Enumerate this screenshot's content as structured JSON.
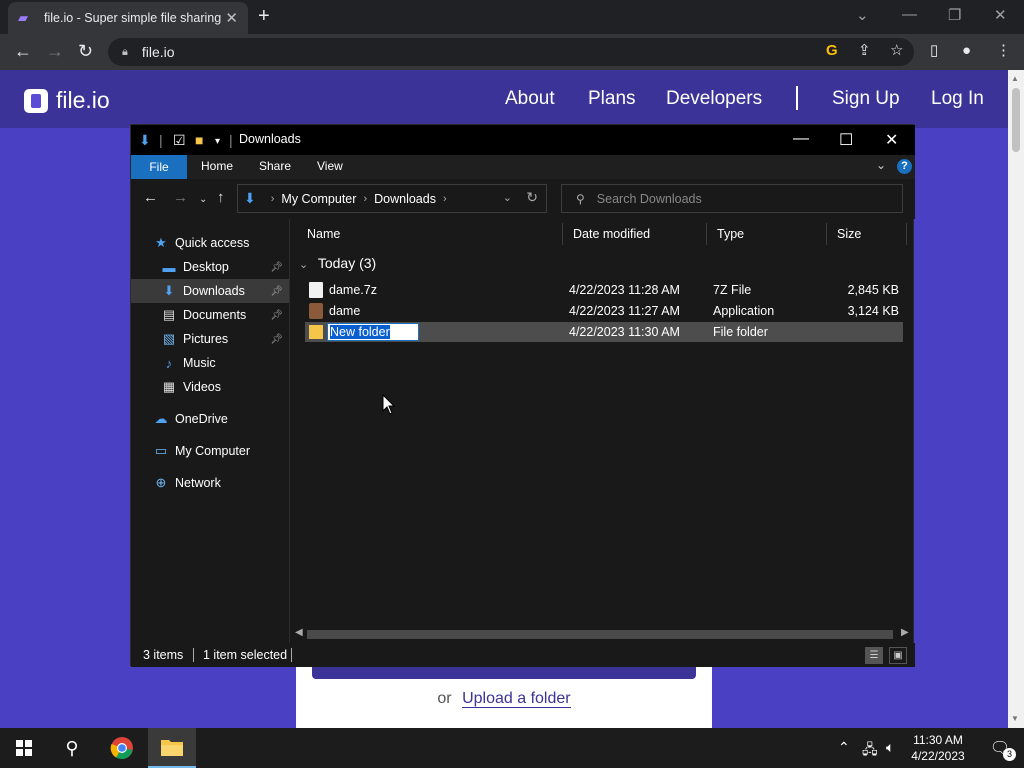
{
  "browser": {
    "tab_title": "file.io - Super simple file sharing",
    "tab_close": "✕",
    "new_tab": "+",
    "url": "file.io"
  },
  "site": {
    "logo_text": "file.io",
    "nav": {
      "about": "About",
      "plans": "Plans",
      "developers": "Developers",
      "signup": "Sign Up",
      "login": "Log In"
    },
    "upload_or": "or",
    "upload_folder": "Upload a folder"
  },
  "explorer": {
    "title": "Downloads",
    "ribbon": {
      "file": "File",
      "home": "Home",
      "share": "Share",
      "view": "View",
      "help": "?"
    },
    "breadcrumb": [
      "My Computer",
      "Downloads"
    ],
    "search_placeholder": "Search Downloads",
    "nav_items": [
      {
        "label": "Quick access",
        "icon": "star-icon"
      },
      {
        "label": "Desktop",
        "icon": "desktop-icon"
      },
      {
        "label": "Downloads",
        "icon": "download-icon"
      },
      {
        "label": "Documents",
        "icon": "document-icon"
      },
      {
        "label": "Pictures",
        "icon": "picture-icon"
      },
      {
        "label": "Music",
        "icon": "music-icon"
      },
      {
        "label": "Videos",
        "icon": "video-icon"
      },
      {
        "label": "OneDrive",
        "icon": "cloud-icon"
      },
      {
        "label": "My Computer",
        "icon": "computer-icon"
      },
      {
        "label": "Network",
        "icon": "network-icon"
      }
    ],
    "columns": {
      "name": "Name",
      "date": "Date modified",
      "type": "Type",
      "size": "Size"
    },
    "group_label": "Today (3)",
    "files": [
      {
        "name": "dame.7z",
        "date": "4/22/2023 11:28 AM",
        "type": "7Z File",
        "size": "2,845 KB"
      },
      {
        "name": "dame",
        "date": "4/22/2023 11:27 AM",
        "type": "Application",
        "size": "3,124 KB"
      },
      {
        "name": "New folder",
        "date": "4/22/2023 11:30 AM",
        "type": "File folder",
        "size": ""
      }
    ],
    "status": {
      "items": "3 items",
      "selected": "1 item selected"
    }
  },
  "taskbar": {
    "time": "11:30 AM",
    "date": "4/22/2023",
    "notification_count": "3"
  }
}
